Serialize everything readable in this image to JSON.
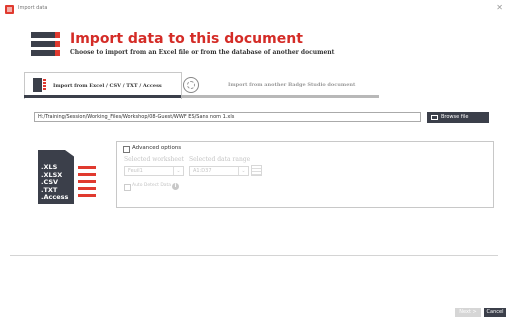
{
  "window": {
    "title": "Import data",
    "close_glyph": "✕"
  },
  "header": {
    "title": "Import data to this document",
    "subtitle": "Choose to import from an Excel file or from the database of another document",
    "icon": "database-stack-icon"
  },
  "tabs": [
    {
      "label": "Import from Excel / CSV / TXT / Access",
      "active": true,
      "icon": "excel-file-icon"
    },
    {
      "label": "Import from another Badge Studio document",
      "active": false,
      "icon": "badge-document-icon"
    }
  ],
  "file": {
    "path": "H:/Training/Session/Working_Files/Workshop/08-Guest/WWF ES/Sans nom 1.xls",
    "browse_label": "Browse file"
  },
  "formats": {
    "text": ".XLS\n.XLSX\n.CSV\n.TXT\n.Access",
    "icon": "spreadsheet-formats-icon"
  },
  "advanced": {
    "label": "Advanced options",
    "checked": false,
    "worksheet_label": "Selected worksheet",
    "worksheet_value": "Feuil1",
    "range_label": "Selected data range",
    "range_value": "A1:D37",
    "autodetect_label": "Auto Detect Data",
    "info_glyph": "i"
  },
  "footer": {
    "next_label": "Next >",
    "cancel_label": "Cancel"
  },
  "colors": {
    "accent": "#d42c27",
    "dark": "#3b3f4a",
    "disabled": "#d6d6d6"
  }
}
